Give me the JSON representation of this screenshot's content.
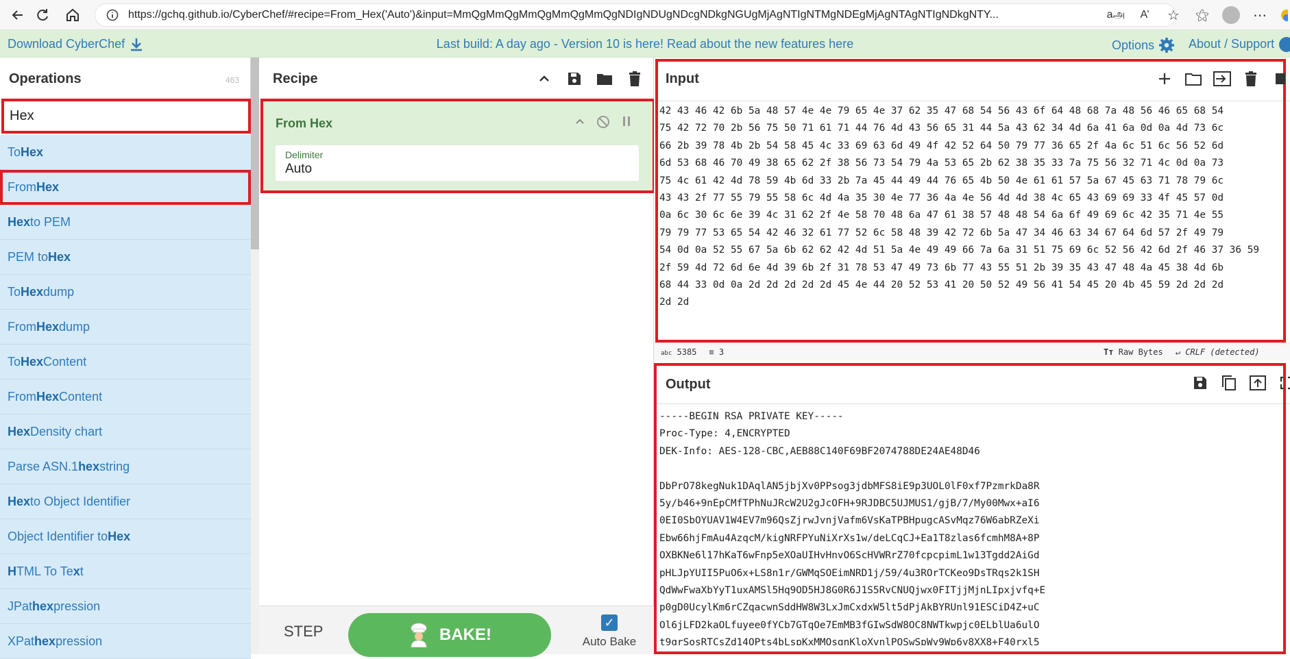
{
  "browser": {
    "url": "https://gchq.github.io/CyberChef/#recipe=From_Hex('Auto')&input=MmQgMmQgMmQgMmQgMmQgNDIgNDUgNDcgNDkgNGUgMjAgNTIgNTMgNDEgMjAgNTAgNTIgNDkgNTY..."
  },
  "banner": {
    "download": "Download CyberChef",
    "notice": "Last build: A day ago - Version 10 is here! Read about the new features here",
    "options": "Options",
    "about": "About / Support"
  },
  "operations": {
    "title": "Operations",
    "count": "463",
    "search_value": "Hex",
    "items": [
      {
        "pre": "To ",
        "match": "Hex",
        "post": ""
      },
      {
        "pre": "From ",
        "match": "Hex",
        "post": ""
      },
      {
        "pre": "",
        "match": "Hex",
        "post": " to PEM"
      },
      {
        "pre": "PEM to ",
        "match": "Hex",
        "post": ""
      },
      {
        "pre": "To ",
        "match": "Hex",
        "post": "dump"
      },
      {
        "pre": "From ",
        "match": "Hex",
        "post": "dump"
      },
      {
        "pre": "To ",
        "match": "Hex",
        "post": " Content"
      },
      {
        "pre": "From ",
        "match": "Hex",
        "post": " Content"
      },
      {
        "pre": "",
        "match": "Hex",
        "post": " Density chart"
      },
      {
        "pre": "Parse ASN.1 ",
        "match": "hex",
        "post": " string"
      },
      {
        "pre": "",
        "match": "Hex",
        "post": " to Object Identifier"
      },
      {
        "pre": "Object Identifier to ",
        "match": "Hex",
        "post": ""
      },
      {
        "pre": "",
        "match": "H",
        "post": "TML To Te",
        "match2": "x",
        "post2": "t"
      },
      {
        "pre": "JPat",
        "match": "h",
        "post": " ",
        "match2": "ex",
        "post2": "pression"
      },
      {
        "pre": "XPat",
        "match": "h",
        "post": " ",
        "match2": "ex",
        "post2": "pression"
      }
    ]
  },
  "recipe": {
    "title": "Recipe",
    "op_title": "From Hex",
    "delimiter_label": "Delimiter",
    "delimiter_value": "Auto",
    "step": "STEP",
    "bake": "BAKE!",
    "auto_bake": "Auto Bake"
  },
  "input": {
    "title": "Input",
    "text": "42 43 46 42 6b 5a 48 57 4e 4e 79 65 4e 37 62 35 47 68 54 56 43 6f 64 48 68 7a 48 56 46 65 68 54\n75 42 72 70 2b 56 75 50 71 61 71 44 76 4d 43 56 65 31 44 5a 43 62 34 4d 6a 41 6a 0d 0a 4d 73 6c\n66 2b 39 78 4b 2b 54 58 45 4c 33 69 63 6d 49 4f 42 52 64 50 79 77 36 65 2f 4a 6c 51 6c 56 52 6d\n6d 53 68 46 70 49 38 65 62 2f 38 56 73 54 79 4a 53 65 2b 62 38 35 33 7a 75 56 32 71 4c 0d 0a 73\n75 4c 61 42 4d 78 59 4b 6d 33 2b 7a 45 44 49 44 76 65 4b 50 4e 61 61 57 5a 67 45 63 71 78 79 6c\n43 43 2f 77 55 79 55 58 6c 4d 4a 35 30 4e 77 36 4a 4e 56 4d 4d 38 4c 65 43 69 69 33 4f 45 57 0d\n0a 6c 30 6c 6e 39 4c 31 62 2f 4e 58 70 48 6a 47 61 38 57 48 48 54 6a 6f 49 69 6c 42 35 71 4e 55\n79 79 77 53 65 54 42 46 32 61 77 52 6c 58 48 39 42 72 6b 5a 47 34 46 63 34 67 64 6d 57 2f 49 79\n54 0d 0a 52 55 67 5a 6b 62 62 42 4d 51 5a 4e 49 49 66 7a 6a 31 51 75 69 6c 52 56 42 6d 2f 46 37 36 59\n2f 59 4d 72 6d 6e 4d 39 6b 2f 31 78 53 47 49 73 6b 77 43 55 51 2b 39 35 43 47 48 4a 45 38 4d 6b\n68 44 33 0d 0a 2d 2d 2d 2d 2d 45 4e 44 20 52 53 41 20 50 52 49 56 41 54 45 20 4b 45 59 2d 2d 2d\n2d 2d",
    "chars": "5385",
    "lines": "3",
    "raw_bytes": "Raw Bytes",
    "eol": "CRLF (detected)"
  },
  "output": {
    "title": "Output",
    "text": "-----BEGIN RSA PRIVATE KEY-----\nProc-Type: 4,ENCRYPTED\nDEK-Info: AES-128-CBC,AEB88C140F69BF2074788DE24AE48D46\n\nDbPrO78kegNuk1DAqlAN5jbjXv0PPsog3jdbMFS8iE9p3UOL0lF0xf7PzmrkDa8R\n5y/b46+9nEpCMfTPhNuJRcW2U2gJcOFH+9RJDBC5UJMUS1/gjB/7/My00Mwx+aI6\n0EI0SbOYUAV1W4EV7m96QsZjrwJvnjVafm6VsKaTPBHpugcASvMqz76W6abRZeXi\nEbw66hjFmAu4AzqcM/kigNRFPYuNiXrXs1w/deLCqCJ+Ea1T8zlas6fcmhM8A+8P\nOXBKNe6l17hKaT6wFnp5eXOaUIHvHnvO6ScHVWRrZ70fcpcpimL1w13Tgdd2AiGd\npHLJpYUII5PuO6x+LS8n1r/GWMqSOEimNRD1j/59/4u3ROrTCKeo9DsTRqs2k1SH\nQdWwFwaXbYyT1uxAMSl5Hq9OD5HJ8G0R6J1S5RvCNUQjwx0FITjjMjnLIpxjvfq+E\np0gD0UcylKm6rCZqacwnSddHW8W3LxJmCxdxW5lt5dPjAkBYRUnl91ESCiD4Z+uC\nOl6jLFD2kaOLfuyee0fYCb7GTqOe7EmMB3fGIwSdW8OC8NWTkwpjc0ELblUa6ulO\nt9grSosRTCsZd14OPts4bLspKxMMOsgnKloXvnlPOSwSpWy9Wp6y8XX8+F40rxl5"
  }
}
